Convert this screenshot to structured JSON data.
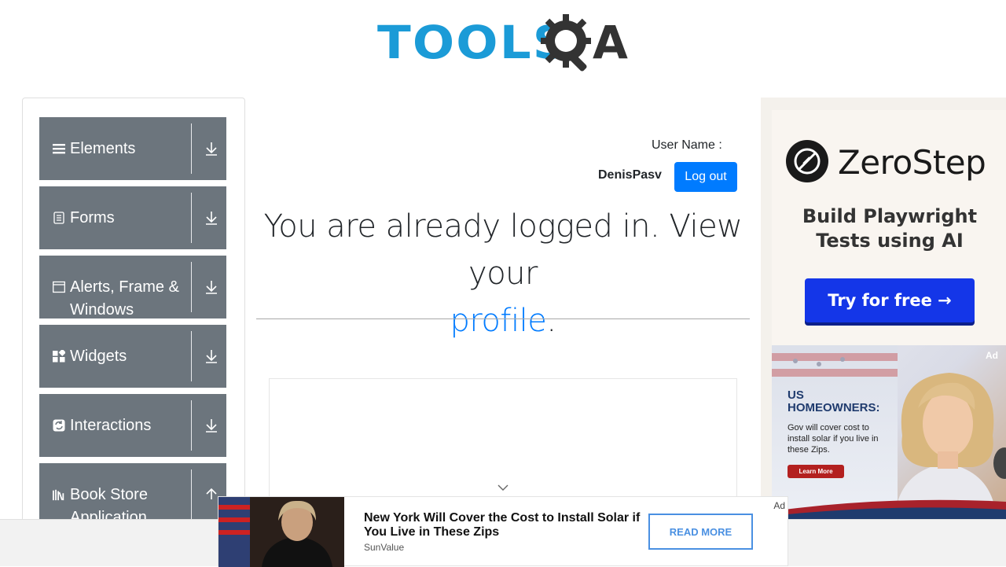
{
  "header": {
    "logo_text": "TOOLS",
    "logo_letter": "A",
    "logo_icon": "gear-magnifier-icon"
  },
  "sidebar": {
    "groups": [
      {
        "label": "Elements",
        "icon": "hamburger-icon",
        "toggle": "download-icon"
      },
      {
        "label": "Forms",
        "icon": "document-icon",
        "toggle": "download-icon"
      },
      {
        "label": "Alerts, Frame & Windows",
        "icon": "window-icon",
        "toggle": "download-icon"
      },
      {
        "label": "Widgets",
        "icon": "widgets-icon",
        "toggle": "download-icon"
      },
      {
        "label": "Interactions",
        "icon": "refresh-icon",
        "toggle": "download-icon"
      },
      {
        "label": "Book Store Application",
        "icon": "books-icon",
        "toggle": "upload-icon"
      }
    ]
  },
  "main": {
    "user_name_label": "User Name :",
    "user_name_value": "DenisPasv",
    "logout_label": "Log out",
    "message_prefix": "You are already logged in. View your",
    "message_link": "profile",
    "message_suffix": "."
  },
  "right_ad": {
    "brand": "ZeroStep",
    "tagline": "Build Playwright Tests using AI",
    "cta": "Try for free →",
    "badge": "Ad",
    "solar_heading_1": "US",
    "solar_heading_2": "HOMEOWNERS:",
    "solar_text": "Gov will cover cost to install solar if you live in these Zips.",
    "solar_button": "Learn More"
  },
  "bottom_ad": {
    "headline": "New York Will Cover the Cost to Install Solar if You Live in These Zips",
    "source": "SunValue",
    "button": "READ MORE",
    "badge": "Ad"
  }
}
